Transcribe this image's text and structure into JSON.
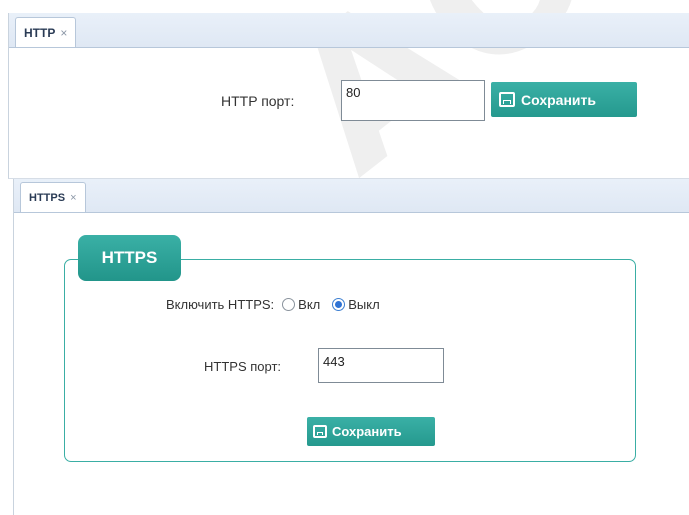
{
  "watermark": "АО \"П",
  "http_panel": {
    "tab_label": "HTTP",
    "tab_close": "×",
    "port_label": "HTTP порт:",
    "port_value": "80",
    "save_label": "Сохранить"
  },
  "https_panel": {
    "tab_label": "HTTPS",
    "tab_close": "×",
    "legend": "HTTPS",
    "enable_label": "Включить HTTPS:",
    "options": [
      {
        "label": "Вкл",
        "checked": false
      },
      {
        "label": "Выкл",
        "checked": true
      }
    ],
    "port_label": "HTTPS порт:",
    "port_value": "443",
    "save_label": "Сохранить"
  },
  "colors": {
    "accent": "#2aa39a",
    "tabbar": "#e3ebf6",
    "radio_selected": "#2f73d4"
  }
}
